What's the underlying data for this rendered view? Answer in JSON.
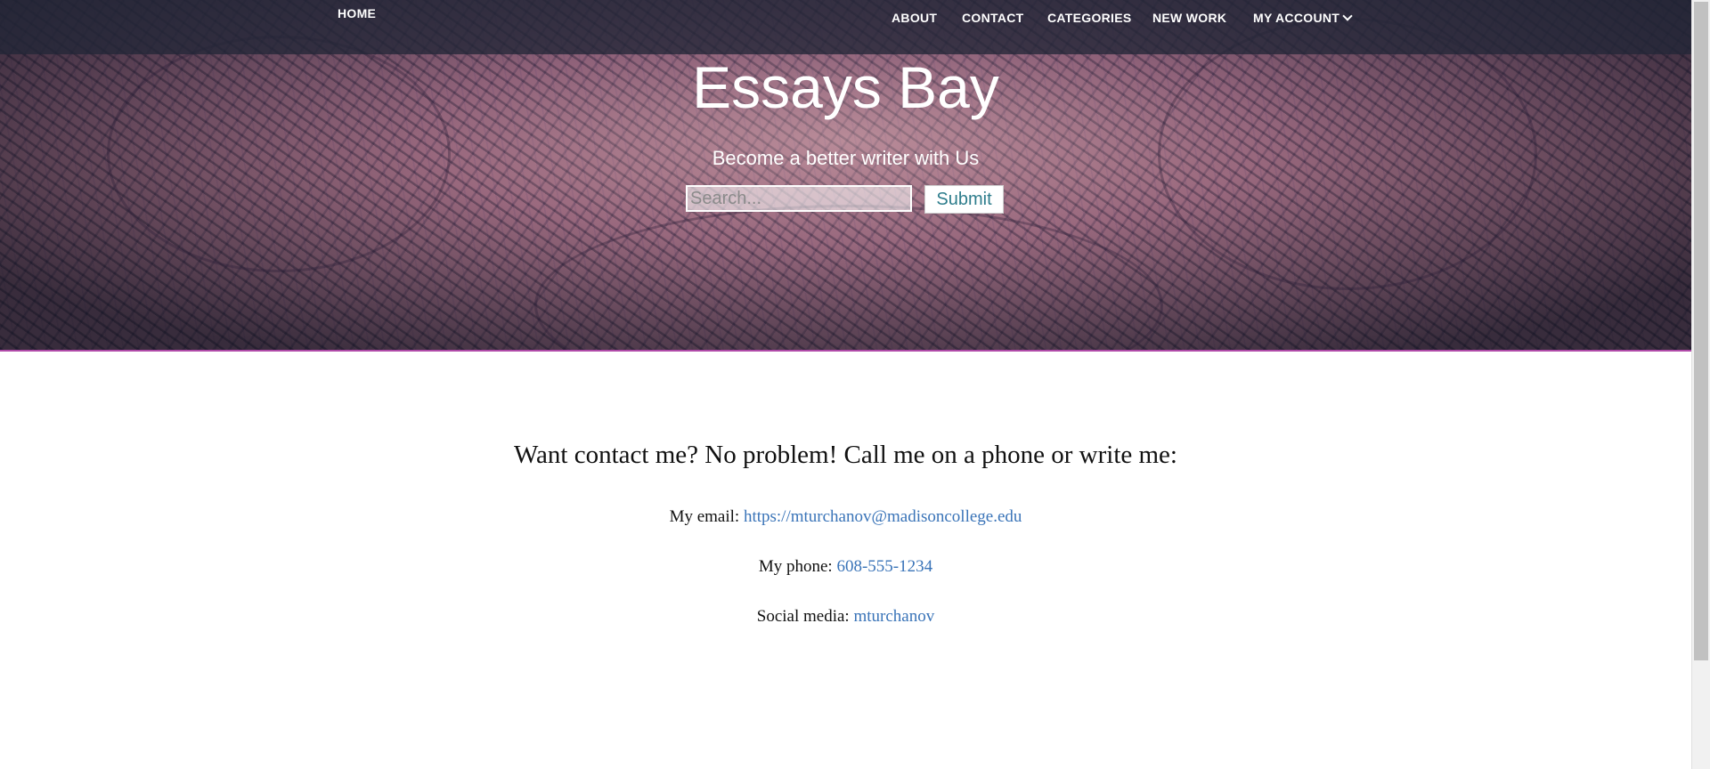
{
  "nav": {
    "home": "HOME",
    "about": "ABOUT",
    "contact": "CONTACT",
    "categories": "CATEGORIES",
    "new_work": "NEW WORK",
    "my_account": "MY ACCOUNT"
  },
  "hero": {
    "title": "Essays Bay",
    "tagline": "Become a better writer with Us",
    "search_placeholder": "Search...",
    "submit_label": "Submit"
  },
  "contact": {
    "heading": "Want contact me? No problem! Call me on a phone or write me:",
    "email_label": "My email:",
    "email_value": "https://mturchanov@madisoncollege.edu",
    "phone_label": "My phone:",
    "phone_value": "608-555-1234",
    "social_label": "Social media:",
    "social_value": "mturchanov"
  },
  "colors": {
    "link": "#3a74b8",
    "hero_border": "#b04aa8",
    "submit_text": "#2e7d8c"
  },
  "icons": {
    "account_dropdown": "chevron-down-icon"
  }
}
